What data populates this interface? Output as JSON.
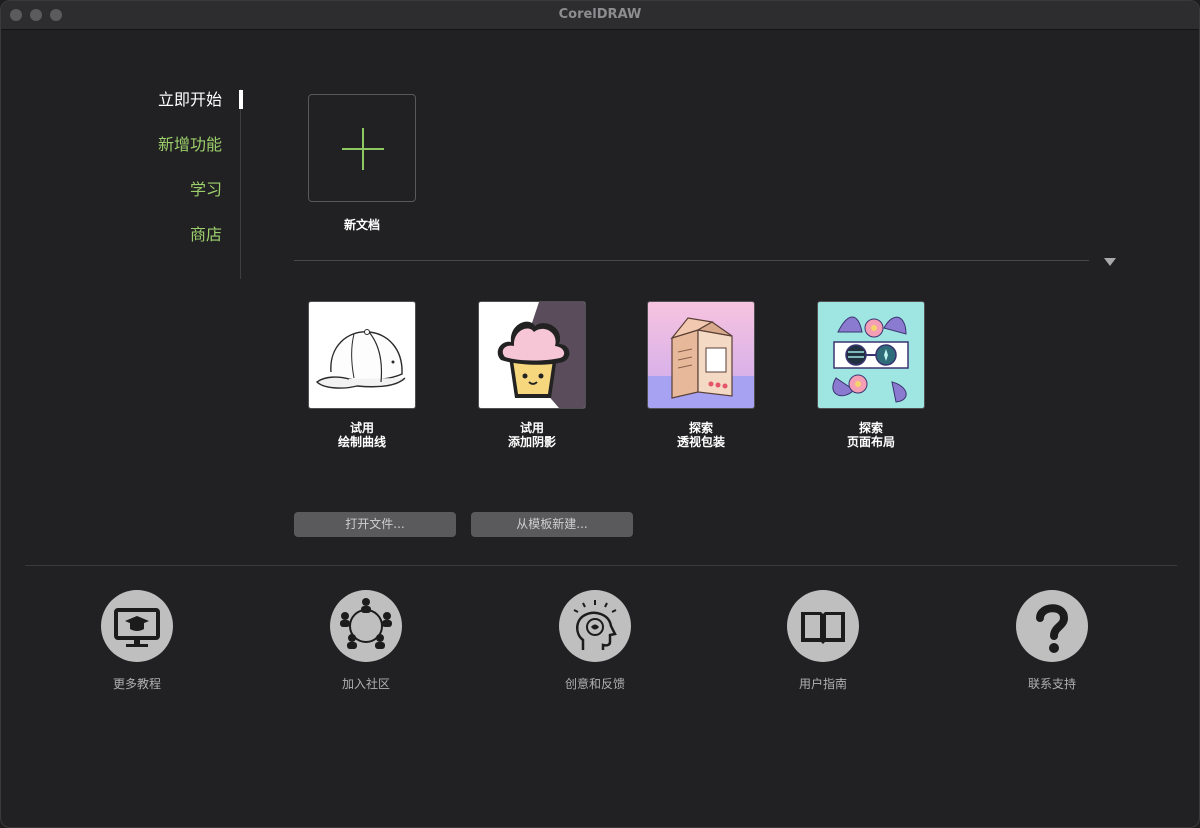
{
  "window": {
    "title": "CorelDRAW"
  },
  "sidebar": {
    "items": [
      {
        "label": "立即开始",
        "active": true
      },
      {
        "label": "新增功能",
        "active": false
      },
      {
        "label": "学习",
        "active": false
      },
      {
        "label": "商店",
        "active": false
      }
    ]
  },
  "new_document": {
    "label": "新文档",
    "icon": "plus-icon"
  },
  "templates": [
    {
      "line1": "试用",
      "line2": "绘制曲线",
      "icon": "cap-thumbnail"
    },
    {
      "line1": "试用",
      "line2": "添加阴影",
      "icon": "cupcake-thumbnail"
    },
    {
      "line1": "探索",
      "line2": "透视包装",
      "icon": "milk-carton-thumbnail"
    },
    {
      "line1": "探索",
      "line2": "页面布局",
      "icon": "flower-glasses-thumbnail"
    }
  ],
  "buttons": {
    "open_file": "打开文件...",
    "new_from_template": "从模板新建..."
  },
  "resources": [
    {
      "label": "更多教程",
      "icon": "tutorial-monitor-icon"
    },
    {
      "label": "加入社区",
      "icon": "community-icon"
    },
    {
      "label": "创意和反馈",
      "icon": "idea-feedback-icon"
    },
    {
      "label": "用户指南",
      "icon": "book-icon"
    },
    {
      "label": "联系支持",
      "icon": "question-icon"
    }
  ],
  "colors": {
    "accent_green": "#9ccf6b",
    "background": "#212123",
    "icon_circle": "#bfbfbf"
  }
}
